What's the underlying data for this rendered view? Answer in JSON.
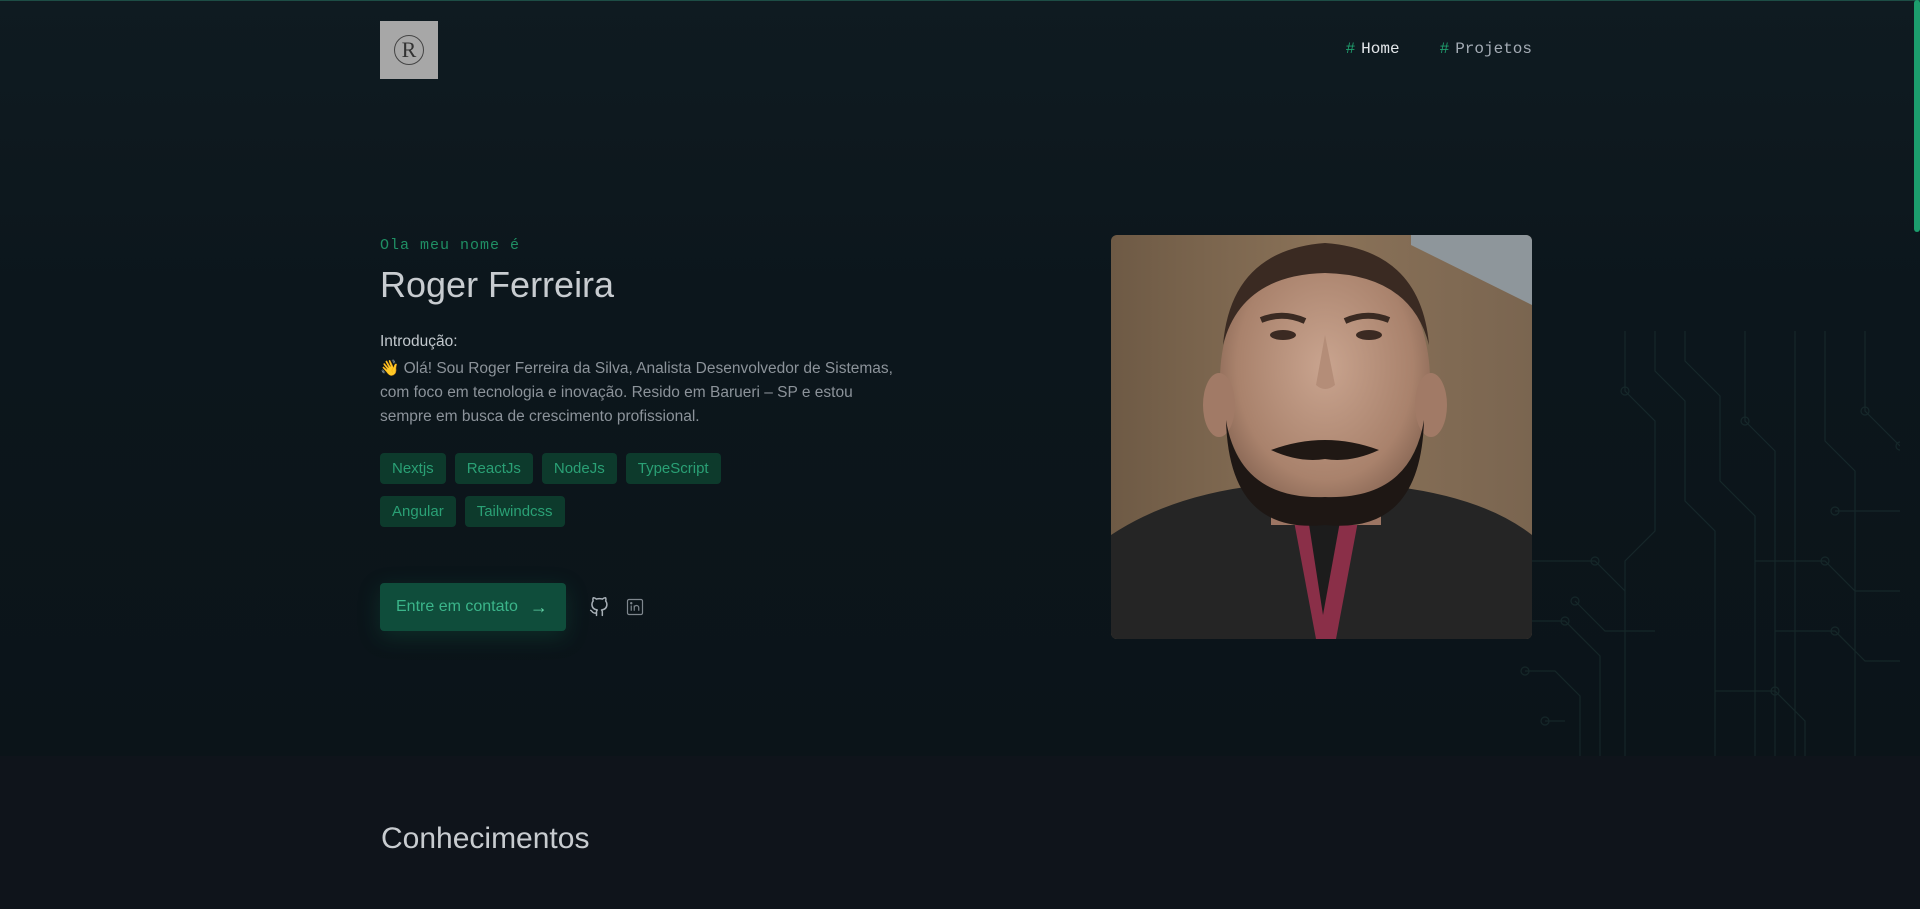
{
  "header": {
    "logo_letter": "R",
    "nav": [
      {
        "hash": "#",
        "label": "Home",
        "active": true
      },
      {
        "hash": "#",
        "label": "Projetos",
        "active": false
      }
    ]
  },
  "hero": {
    "greeting": "Ola meu nome é",
    "name": "Roger Ferreira",
    "intro_label": "Introdução:",
    "intro_text": "👋 Olá! Sou Roger Ferreira da Silva, Analista Desenvolvedor de Sistemas, com foco em tecnologia e inovação. Resido em Barueri – SP e estou sempre em busca de crescimento profissional.",
    "tags": [
      "Nextjs",
      "ReactJs",
      "NodeJs",
      "TypeScript",
      "Angular",
      "Tailwindcss"
    ],
    "contact_label": "Entre em contato",
    "contact_arrow": "→",
    "social_icons": [
      "github-icon",
      "linkedin-icon"
    ]
  },
  "knowledge": {
    "title": "Conhecimentos"
  },
  "colors": {
    "accent": "#1f9e6d",
    "background": "#0f141b",
    "tag_bg": "#0d3a2c"
  }
}
